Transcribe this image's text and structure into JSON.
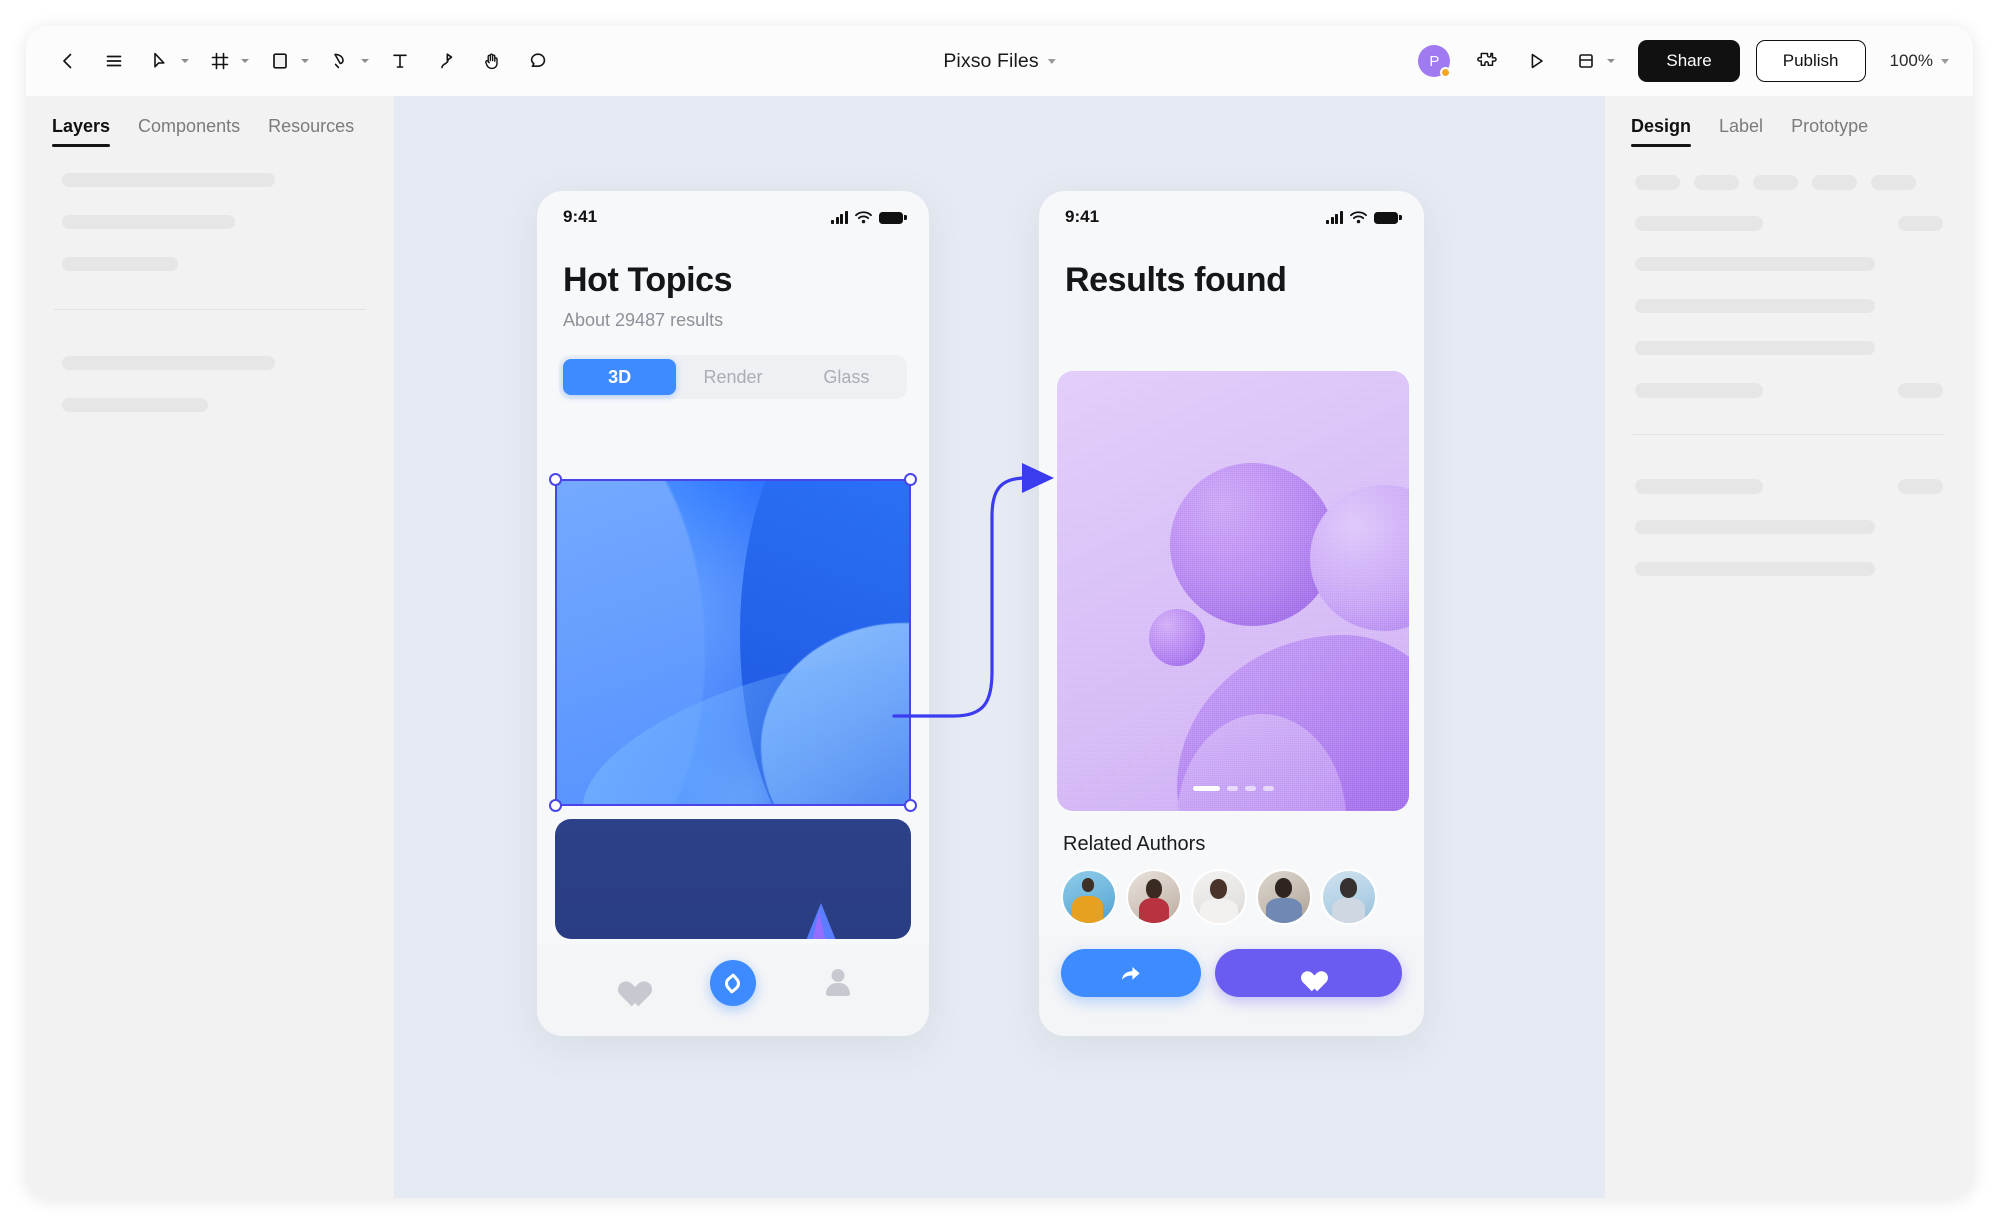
{
  "app": {
    "title": "Pixso Files",
    "zoom": "100%",
    "avatar_initial": "P"
  },
  "toolbar": {
    "items": [
      {
        "name": "back-icon",
        "glyph": "back",
        "caret": false
      },
      {
        "name": "menu-icon",
        "glyph": "menu",
        "caret": false
      },
      {
        "name": "move-tool-icon",
        "glyph": "cursor",
        "caret": true
      },
      {
        "name": "frame-tool-icon",
        "glyph": "frame",
        "caret": true
      },
      {
        "name": "shape-tool-icon",
        "glyph": "rect",
        "caret": true
      },
      {
        "name": "pen-tool-icon",
        "glyph": "pen",
        "caret": true
      },
      {
        "name": "text-tool-icon",
        "glyph": "text",
        "caret": false
      },
      {
        "name": "path-tool-icon",
        "glyph": "path",
        "caret": false
      },
      {
        "name": "hand-tool-icon",
        "glyph": "hand",
        "caret": false
      },
      {
        "name": "comment-tool-icon",
        "glyph": "comment",
        "caret": false
      }
    ],
    "plugin_label": "plugin-icon",
    "present_label": "present-icon",
    "layout_label": "layout-icon",
    "share_label": "Share",
    "publish_label": "Publish"
  },
  "left_panel": {
    "tabs": [
      {
        "label": "Layers",
        "active": true
      },
      {
        "label": "Components",
        "active": false
      },
      {
        "label": "Resources",
        "active": false
      }
    ],
    "skeleton_widths": [
      "68%",
      "55%",
      "38%"
    ],
    "skeleton_widths_2": [
      "68%",
      "48%"
    ]
  },
  "right_panel": {
    "tabs": [
      {
        "label": "Design",
        "active": true
      },
      {
        "label": "Label",
        "active": false
      },
      {
        "label": "Prototype",
        "active": false
      }
    ]
  },
  "canvas": {
    "frames": [
      {
        "name": "hot-topics",
        "status_time": "9:41",
        "title": "Hot Topics",
        "subtitle": "About 29487 results",
        "segments": [
          {
            "label": "3D",
            "active": true
          },
          {
            "label": "Render",
            "active": false
          },
          {
            "label": "Glass",
            "active": false
          }
        ],
        "nav": [
          {
            "name": "nav-favorites-icon"
          },
          {
            "name": "nav-explore-icon"
          },
          {
            "name": "nav-profile-icon"
          }
        ]
      },
      {
        "name": "results-found",
        "status_time": "9:41",
        "title": "Results found",
        "pagination": {
          "total": 4,
          "active_index": 0
        },
        "related_authors_label": "Related Authors",
        "authors": [
          {
            "name": "author-avatar-1"
          },
          {
            "name": "author-avatar-2"
          },
          {
            "name": "author-avatar-3"
          },
          {
            "name": "author-avatar-4"
          },
          {
            "name": "author-avatar-5"
          }
        ],
        "actions": [
          {
            "name": "share-post-button",
            "icon": "share-arrow-icon"
          },
          {
            "name": "like-button",
            "icon": "heart-icon"
          }
        ]
      }
    ],
    "connector": {
      "name": "prototype-connector",
      "color": "#3b3bef"
    },
    "selection": {
      "color": "#4a45e8"
    }
  },
  "colors": {
    "accent_blue": "#3d8bff",
    "accent_purple": "#6a5cf0",
    "selection": "#4a45e8",
    "canvas_bg": "#e6eaf2",
    "panel_bg": "#f2f2f2",
    "share_bg": "#111111"
  }
}
